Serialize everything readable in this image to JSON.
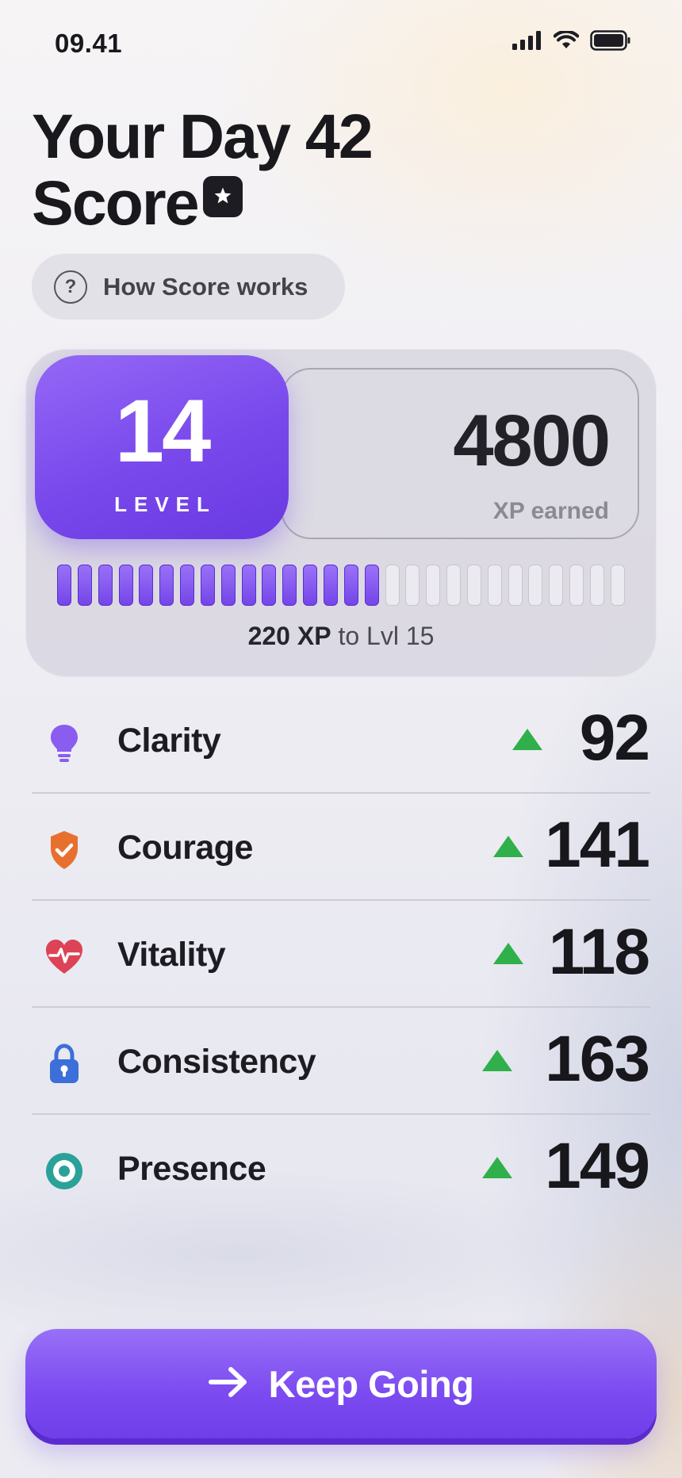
{
  "status_bar": {
    "time": "09.41"
  },
  "header": {
    "title_line1": "Your Day 42",
    "title_line2": "Score"
  },
  "how_it_works": {
    "icon": "?",
    "label": "How Score works"
  },
  "level_card": {
    "level_number": "14",
    "level_label": "LEVEL",
    "xp_value": "4800",
    "xp_label": "XP earned",
    "progress_filled_segments": 16,
    "progress_total_segments": 28,
    "next_level_xp": "220 XP",
    "next_level_text": "to Lvl 15"
  },
  "stats": [
    {
      "icon": "lightbulb-icon",
      "label": "Clarity",
      "value": "92",
      "trend": "up",
      "color": "#8a5cf0"
    },
    {
      "icon": "shield-check-icon",
      "label": "Courage",
      "value": "141",
      "trend": "up",
      "color": "#e8702f"
    },
    {
      "icon": "heart-pulse-icon",
      "label": "Vitality",
      "value": "118",
      "trend": "up",
      "color": "#dc4356"
    },
    {
      "icon": "lock-icon",
      "label": "Consistency",
      "value": "163",
      "trend": "up",
      "color": "#3d6fd8"
    },
    {
      "icon": "target-icon",
      "label": "Presence",
      "value": "149",
      "trend": "up",
      "color": "#2aa29a"
    }
  ],
  "cta": {
    "label": "Keep Going",
    "icon": "arrow-right-icon"
  },
  "colors": {
    "accent": "#7b4af0",
    "trend_up": "#2fb04a"
  }
}
